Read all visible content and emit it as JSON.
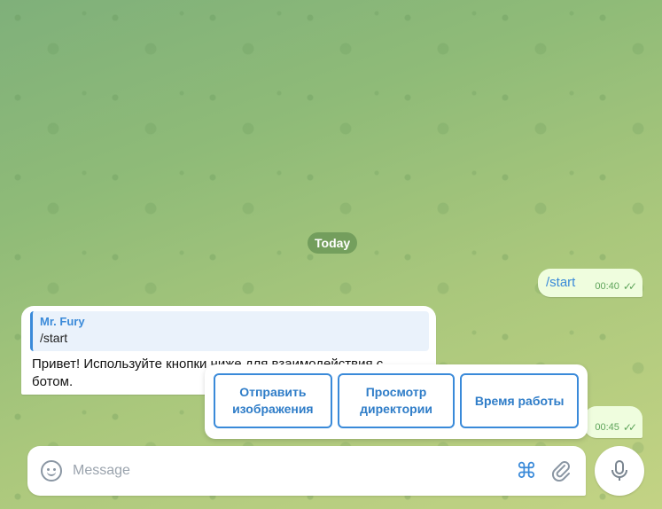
{
  "chat": {
    "date_separator": "Today",
    "messages": [
      {
        "direction": "out",
        "text": "/start",
        "time": "00:40",
        "status": "read"
      },
      {
        "direction": "in",
        "reply_to": {
          "author": "Mr. Fury",
          "text": "/start"
        },
        "text": "Привет! Используйте кнопки ниже для взаимодействия с ботом."
      },
      {
        "direction": "out",
        "text": "",
        "time": "00:45",
        "status": "read"
      }
    ]
  },
  "inline_keyboard": {
    "buttons": [
      {
        "label": "Отправить изображения"
      },
      {
        "label": "Просмотр директории"
      },
      {
        "label": "Время работы"
      }
    ]
  },
  "composer": {
    "placeholder": "Message",
    "icons": [
      "smile-icon",
      "command-icon",
      "paperclip-icon",
      "microphone-icon"
    ]
  },
  "colors": {
    "accent": "#3a8ad9",
    "outgoing_bubble": "#effdde",
    "incoming_bubble": "#ffffff",
    "read_check": "#5fa45b"
  }
}
